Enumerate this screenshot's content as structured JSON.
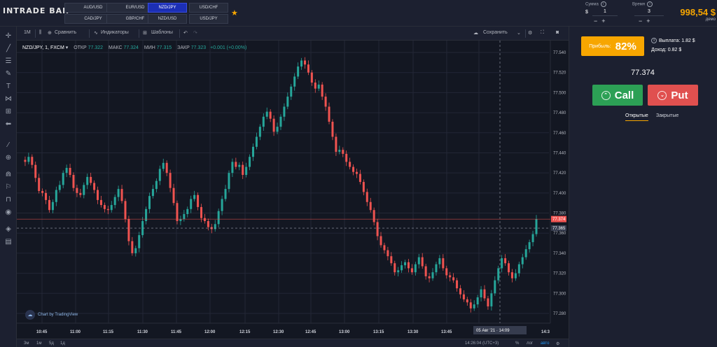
{
  "header": {
    "logo": "INTRADE BAR",
    "pairs": [
      {
        "label": "AUD/USD",
        "active": false
      },
      {
        "label": "EUR/USD",
        "active": false
      },
      {
        "label": "NZD/JPY",
        "active": true
      },
      {
        "label": "USD/CHF",
        "active": false
      },
      {
        "label": "CAD/JPY",
        "active": false
      },
      {
        "label": "GBP/CHF",
        "active": false
      },
      {
        "label": "NZD/USD",
        "active": false
      },
      {
        "label": "USD/JPY",
        "active": false
      }
    ],
    "amount_label": "Сумма",
    "amount_currency": "$",
    "amount_value": "1",
    "time_label": "Время",
    "time_value": "3",
    "minus": "−",
    "plus": "+",
    "info": "i",
    "balance": "998,54 $",
    "account_type": "демо"
  },
  "chart_toolbar": {
    "interval": "1М",
    "compare": "Сравнить",
    "indicators": "Индикаторы",
    "templates": "Шаблоны",
    "save": "Сохранить"
  },
  "legend": {
    "symbol": "NZD/JPY, 1, FXCM",
    "open_label": "ОТКР",
    "open": "77.322",
    "high_label": "МАКС",
    "high": "77.324",
    "low_label": "МИН",
    "low": "77.315",
    "close_label": "ЗАКР",
    "close": "77.323",
    "change": "+0.001 (+0.00%)"
  },
  "tradingview_badge": "Chart by TradingView",
  "bottom_bar": {
    "ranges": [
      "3м",
      "1м",
      "5д",
      "1д"
    ],
    "time": "14:26:04 (UTC+3)",
    "percent": "%",
    "log": "лог",
    "auto": "авто"
  },
  "right_panel": {
    "profit_label": "Прибыль:",
    "profit_value": "82%",
    "payout": "Выплата: 1.82 $",
    "income": "Доход: 0.82 $",
    "price": "77.374",
    "call_label": "Call",
    "put_label": "Put",
    "tab_open": "Открытые",
    "tab_closed": "Закрытые"
  },
  "colors": {
    "up": "#26a69a",
    "down": "#ef5350",
    "accent": "#f7a600"
  },
  "chart_data": {
    "type": "candlestick",
    "y_ticks": [
      "77.540",
      "77.520",
      "77.500",
      "77.480",
      "77.460",
      "77.440",
      "77.420",
      "77.400",
      "77.380",
      "77.360",
      "77.340",
      "77.320",
      "77.300",
      "77.280"
    ],
    "x_ticks": [
      "10:45",
      "11:00",
      "11:15",
      "11:30",
      "11:45",
      "12:00",
      "12:15",
      "12:30",
      "12:45",
      "13:00",
      "13:15",
      "13:30",
      "13:45",
      "14:",
      " 14:3"
    ],
    "ylim": [
      77.274,
      77.55
    ],
    "price_line_label": "77.374",
    "crosshair_label": "77.365",
    "crosshair_price": 77.365,
    "crosshair_time_label": "05 Авг '21 · 14:09",
    "closes": [
      77.433,
      77.431,
      77.436,
      77.428,
      77.415,
      77.402,
      77.4,
      77.393,
      77.383,
      77.391,
      77.403,
      77.408,
      77.42,
      77.425,
      77.418,
      77.405,
      77.4,
      77.398,
      77.408,
      77.416,
      77.41,
      77.403,
      77.393,
      77.388,
      77.384,
      77.383,
      77.388,
      77.396,
      77.404,
      77.392,
      77.374,
      77.352,
      77.34,
      77.345,
      77.358,
      77.372,
      77.384,
      77.397,
      77.404,
      77.412,
      77.424,
      77.43,
      77.42,
      77.405,
      77.39,
      77.372,
      77.374,
      77.379,
      77.384,
      77.394,
      77.398,
      77.386,
      77.375,
      77.372,
      77.366,
      77.364,
      77.369,
      77.382,
      77.394,
      77.404,
      77.42,
      77.431,
      77.426,
      77.428,
      77.418,
      77.426,
      77.436,
      77.446,
      77.456,
      77.466,
      77.476,
      77.481,
      77.474,
      77.461,
      77.466,
      77.476,
      77.486,
      77.496,
      77.506,
      77.516,
      77.526,
      77.532,
      77.528,
      77.52,
      77.51,
      77.504,
      77.508,
      77.496,
      77.486,
      77.471,
      77.456,
      77.441,
      77.443,
      77.439,
      77.431,
      77.426,
      77.421,
      77.419,
      77.411,
      77.401,
      77.391,
      77.383,
      77.371,
      77.357,
      77.348,
      77.343,
      77.337,
      77.33,
      77.321,
      77.323,
      77.328,
      77.331,
      77.325,
      77.321,
      77.329,
      77.336,
      77.327,
      77.317,
      77.315,
      77.321,
      77.329,
      77.335,
      77.325,
      77.318,
      77.316,
      77.313,
      77.305,
      77.299,
      77.294,
      77.291,
      77.285,
      77.289,
      77.296,
      77.304,
      77.295,
      77.287,
      77.3,
      77.313,
      77.325,
      77.335,
      77.33,
      77.321,
      77.315,
      77.32,
      77.329,
      77.336,
      77.344,
      77.351,
      77.359,
      77.374
    ]
  }
}
